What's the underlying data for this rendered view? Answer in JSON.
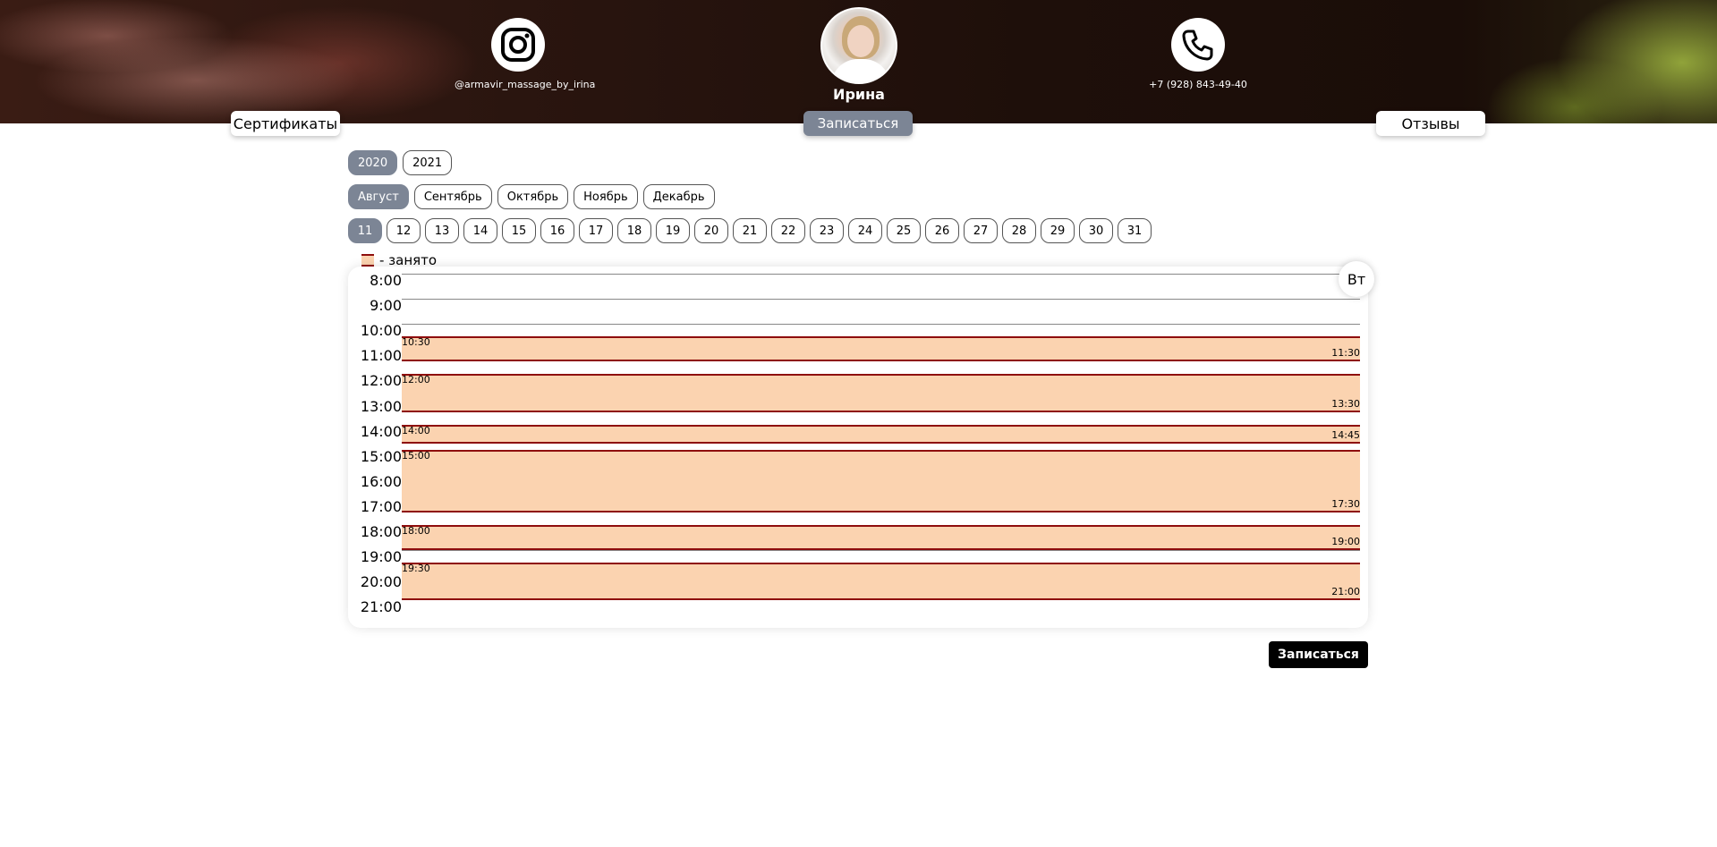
{
  "header": {
    "instagram": {
      "icon": "instagram-icon",
      "handle": "@armavir_massage_by_irina"
    },
    "profile": {
      "name": "Ирина"
    },
    "phone": {
      "icon": "phone-icon",
      "number": "+7 (928) 843-49-40"
    },
    "buttons": {
      "certificates": "Сертификаты",
      "book": "Записаться",
      "reviews": "Отзывы"
    }
  },
  "selectors": {
    "years": [
      {
        "label": "2020",
        "active": true
      },
      {
        "label": "2021",
        "active": false
      }
    ],
    "months": [
      {
        "label": "Август",
        "active": true
      },
      {
        "label": "Сентябрь",
        "active": false
      },
      {
        "label": "Октябрь",
        "active": false
      },
      {
        "label": "Ноябрь",
        "active": false
      },
      {
        "label": "Декабрь",
        "active": false
      }
    ],
    "days": [
      {
        "label": "11",
        "active": true
      },
      {
        "label": "12",
        "active": false
      },
      {
        "label": "13",
        "active": false
      },
      {
        "label": "14",
        "active": false
      },
      {
        "label": "15",
        "active": false
      },
      {
        "label": "16",
        "active": false
      },
      {
        "label": "17",
        "active": false
      },
      {
        "label": "18",
        "active": false
      },
      {
        "label": "19",
        "active": false
      },
      {
        "label": "20",
        "active": false
      },
      {
        "label": "21",
        "active": false
      },
      {
        "label": "22",
        "active": false
      },
      {
        "label": "23",
        "active": false
      },
      {
        "label": "24",
        "active": false
      },
      {
        "label": "25",
        "active": false
      },
      {
        "label": "26",
        "active": false
      },
      {
        "label": "27",
        "active": false
      },
      {
        "label": "28",
        "active": false
      },
      {
        "label": "29",
        "active": false
      },
      {
        "label": "30",
        "active": false
      },
      {
        "label": "31",
        "active": false
      }
    ]
  },
  "legend": {
    "text": "- занято"
  },
  "schedule": {
    "weekday": "Вт",
    "hours": [
      "8:00",
      "9:00",
      "10:00",
      "11:00",
      "12:00",
      "13:00",
      "14:00",
      "15:00",
      "16:00",
      "17:00",
      "18:00",
      "19:00",
      "20:00",
      "21:00"
    ],
    "busy": [
      {
        "start": "10:30",
        "end": "11:30"
      },
      {
        "start": "12:00",
        "end": "13:30"
      },
      {
        "start": "14:00",
        "end": "14:45"
      },
      {
        "start": "15:00",
        "end": "17:30"
      },
      {
        "start": "18:00",
        "end": "19:00"
      },
      {
        "start": "19:30",
        "end": "21:00"
      }
    ]
  },
  "footer": {
    "book_button": "Записаться"
  },
  "colors": {
    "accent": "#7c8595",
    "busy_fill": "#fbd3b0",
    "busy_border": "#8e0d0d"
  }
}
